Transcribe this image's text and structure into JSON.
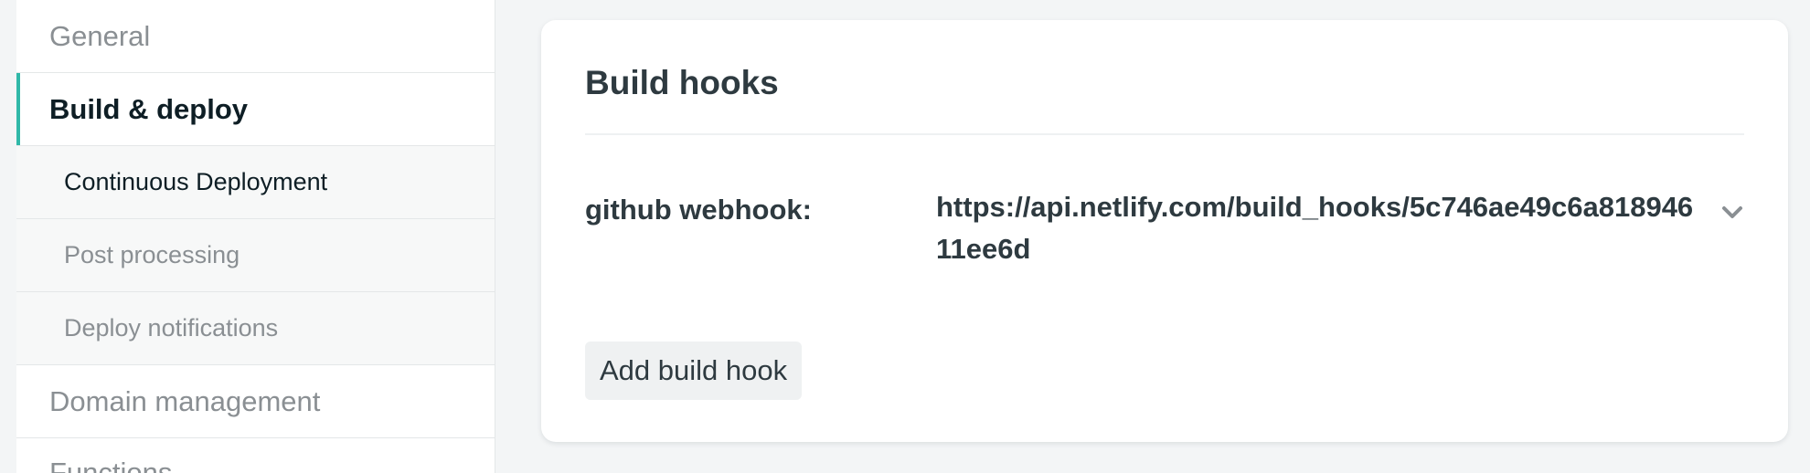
{
  "sidebar": {
    "items": [
      {
        "label": "General"
      },
      {
        "label": "Build & deploy"
      },
      {
        "label": "Continuous Deployment"
      },
      {
        "label": "Post processing"
      },
      {
        "label": "Deploy notifications"
      },
      {
        "label": "Domain management"
      },
      {
        "label": "Functions"
      }
    ]
  },
  "main": {
    "title": "Build hooks",
    "hook": {
      "label": "github webhook:",
      "url": "https://api.netlify.com/build_hooks/5c746ae49c6a81894611ee6d",
      "expand_icon": "chevron-down-icon"
    },
    "add_button_label": "Add build hook"
  },
  "colors": {
    "accent": "#30b8a8",
    "text_dark": "#2e3a40",
    "text_muted": "#8a8f93",
    "page_bg": "#f3f5f6"
  }
}
